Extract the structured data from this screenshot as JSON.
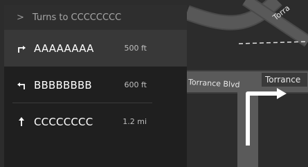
{
  "panel": {
    "header": "Turns to CCCCCCCC",
    "steps": [
      {
        "name": "AAAAAAAA",
        "distance": "500 ft",
        "icon": "turn-right-icon"
      },
      {
        "name": "BBBBBBBB",
        "distance": "600 ft",
        "icon": "turn-left-icon"
      },
      {
        "name": "CCCCCCCC",
        "distance": "1.2 mi",
        "icon": "straight-arrow-icon"
      }
    ]
  },
  "map": {
    "street_label_1": "Torrance Blvd",
    "street_label_2": "Torrance",
    "street_label_3": "Torra"
  },
  "colors": {
    "panel_bg": "#1f1f1f",
    "header_bg": "#2e2e2e",
    "active_row_bg": "#383838",
    "map_bg": "#2f2f2f",
    "road": "#5c5c5c"
  }
}
